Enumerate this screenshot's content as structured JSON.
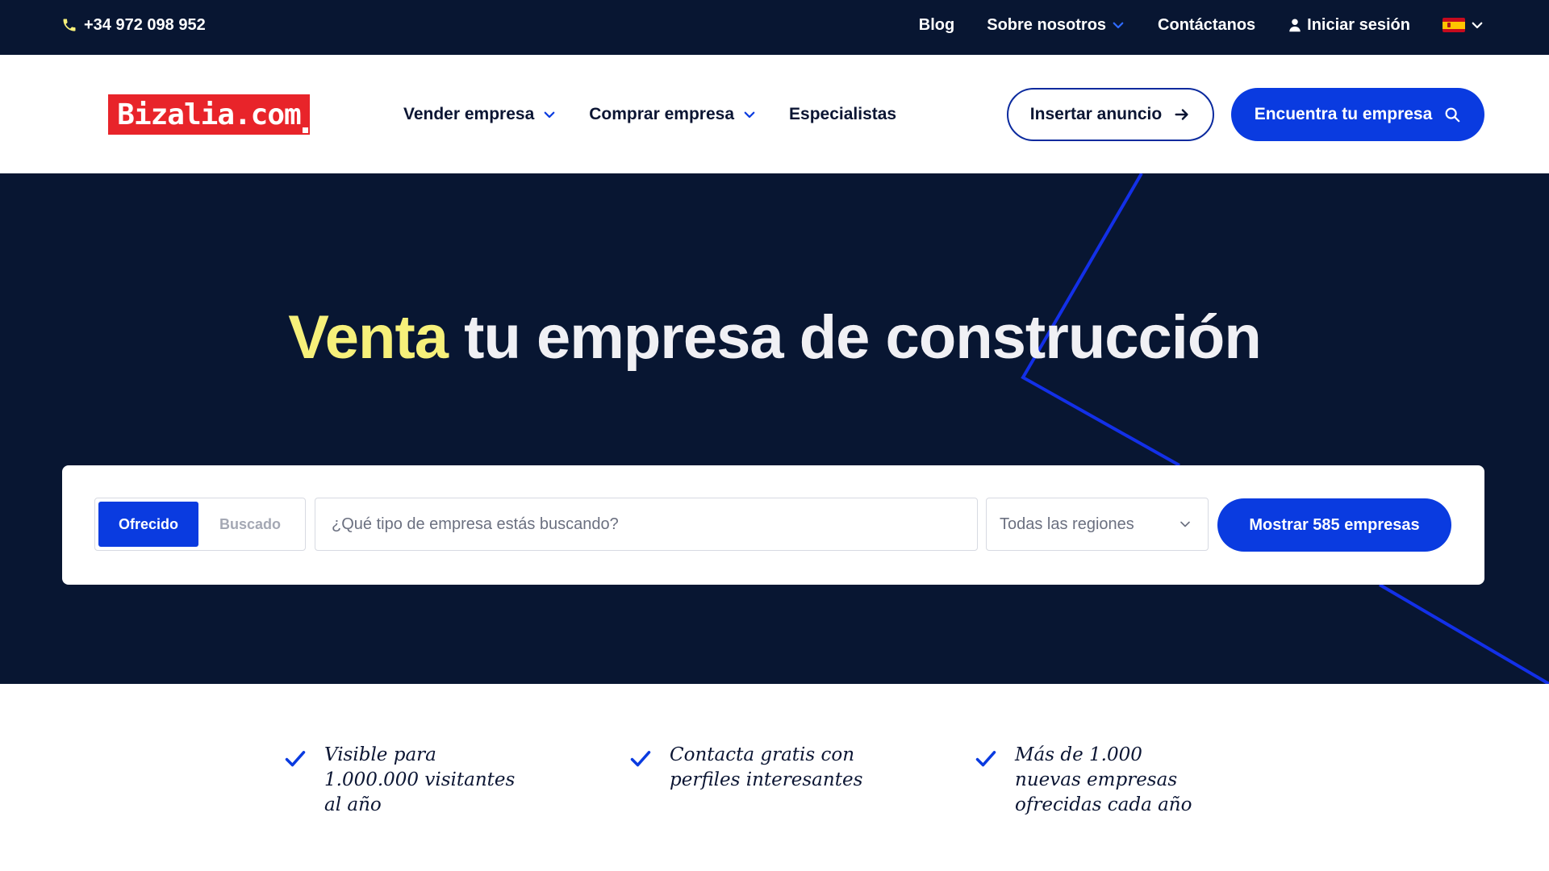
{
  "topbar": {
    "phone": "+34 972 098 952",
    "blog": "Blog",
    "about": "Sobre nosotros",
    "contact": "Contáctanos",
    "login": "Iniciar sesión"
  },
  "header": {
    "logo_text": "Bizalia.com",
    "nav": {
      "sell": "Vender empresa",
      "buy": "Comprar empresa",
      "specialists": "Especialistas"
    },
    "insert_ad": "Insertar anuncio",
    "find_company": "Encuentra tu empresa"
  },
  "hero": {
    "headline_highlight": "Venta",
    "headline_rest": " tu empresa de construcción"
  },
  "search": {
    "toggle_offered": "Ofrecido",
    "toggle_wanted": "Buscado",
    "placeholder": "¿Qué tipo de empresa estás buscando?",
    "region": "Todas las regiones",
    "submit": "Mostrar 585 empresas"
  },
  "features": [
    "Visible para 1.000.000 visitantes al año",
    "Contacta gratis con perfiles interesantes",
    "Más de 1.000 nuevas empresas ofrecidas cada año"
  ],
  "colors": {
    "navy": "#081632",
    "accent_blue": "#0a3be0",
    "highlight_yellow": "#f6f07a",
    "logo_red": "#e8242a",
    "line_blue": "#1330e8"
  },
  "icons": {
    "phone": "phone-icon",
    "chevron": "chevron-down-icon",
    "user": "user-icon",
    "flag": "spain-flag-icon",
    "arrow": "arrow-right-icon",
    "search": "search-icon",
    "check": "check-icon"
  }
}
